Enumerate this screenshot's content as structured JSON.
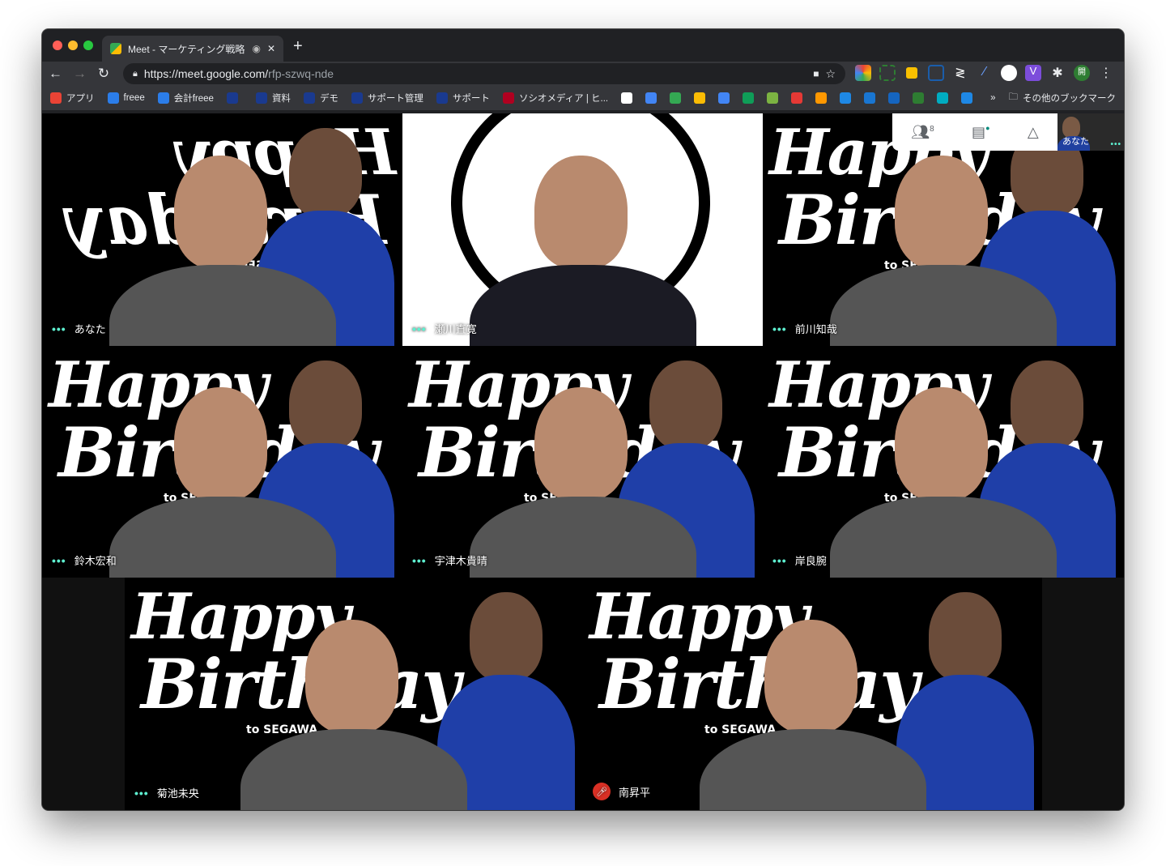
{
  "browser": {
    "tab_title": "Meet - マーケティング戦略M",
    "url_host": "https://meet.google.com/",
    "url_path": "rfp-szwq-nde",
    "bookmarks": [
      {
        "label": "アプリ",
        "color": "#ea4335"
      },
      {
        "label": "freee",
        "color": "#2b7de9"
      },
      {
        "label": "会計freee",
        "color": "#2b7de9"
      },
      {
        "label": "",
        "color": "#1a3a8f"
      },
      {
        "label": "資料",
        "color": "#1a3a8f"
      },
      {
        "label": "デモ",
        "color": "#1a3a8f"
      },
      {
        "label": "サポート管理",
        "color": "#1a3a8f"
      },
      {
        "label": "サポート",
        "color": "#1a3a8f"
      },
      {
        "label": "ソシオメディア | ヒ...",
        "color": "#b00020"
      }
    ],
    "other_bookmarks": "その他のブックマーク",
    "overflow": "»",
    "profile_initial": "開"
  },
  "meet": {
    "participants_count": "8",
    "self_label": "あなた",
    "tiles": [
      {
        "name": "あなた",
        "bg": "#000"
      },
      {
        "name": "瀬川直寛",
        "bg": "#fff"
      },
      {
        "name": "前川知哉",
        "bg": "#000"
      },
      {
        "name": "鈴木宏和",
        "bg": "#000"
      },
      {
        "name": "宇津木貴晴",
        "bg": "#000"
      },
      {
        "name": "岸良腕",
        "bg": "#000"
      },
      {
        "name": "菊池未央",
        "bg": "#000"
      },
      {
        "name": "南昇平",
        "bg": "#000",
        "muted": true
      }
    ],
    "bg_line1": "Happy",
    "bg_line2": "Birthday",
    "bg_line3": "to SEGAWA"
  }
}
